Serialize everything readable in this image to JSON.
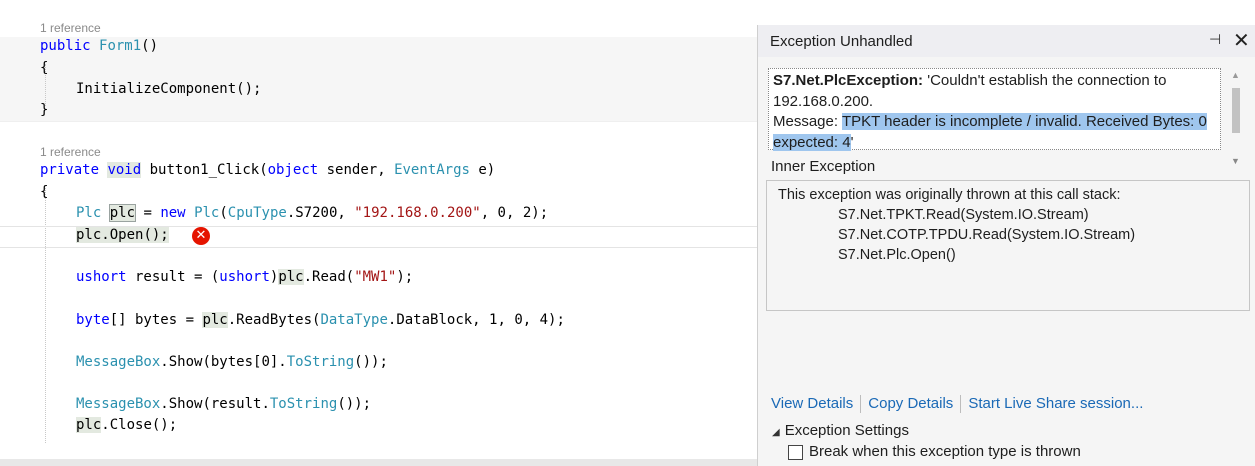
{
  "code": {
    "codelens_1": "1 reference",
    "line1": {
      "kw": "public",
      "name": "Form1",
      "rest": "()"
    },
    "brace_open_1": "{",
    "line_init": "InitializeComponent();",
    "brace_close_1": "}",
    "codelens_2": "1 reference",
    "line2": {
      "kw1": "private",
      "kw2": "void",
      "name": "button1_Click",
      "p1": "(",
      "kw3": "object",
      "p2": " sender, ",
      "type": "EventArgs",
      "p3": " e)"
    },
    "brace_open_2": "{",
    "line_plc": {
      "type1": "Plc",
      "var": "plc",
      "eq": " = ",
      "kw": "new",
      "type2": "Plc",
      "p1": "(",
      "type3": "CpuType",
      "p2": ".S7200, ",
      "str": "\"192.168.0.200\"",
      "p3": ", 0, 2);"
    },
    "line_open": {
      "var": "plc",
      "rest": ".Open();"
    },
    "line_read": {
      "kw": "ushort",
      "p1": " result = (",
      "kw2": "ushort",
      "p2": ")",
      "var": "plc",
      "p3": ".Read(",
      "str": "\"MW1\"",
      "p4": ");"
    },
    "line_bytes": {
      "kw": "byte",
      "p1": "[] bytes = ",
      "var": "plc",
      "p2": ".ReadBytes(",
      "type": "DataType",
      "p3": ".DataBlock, 1, 0, 4);"
    },
    "line_msg1": {
      "type": "MessageBox",
      "p1": ".Show(bytes[0].",
      "method": "ToString",
      "p2": "());"
    },
    "line_msg2": {
      "type": "MessageBox",
      "p1": ".Show(result.",
      "method": "ToString",
      "p2": "());"
    },
    "line_close": {
      "var": "plc",
      "rest": ".Close();"
    }
  },
  "popup": {
    "title": "Exception Unhandled",
    "pin_icon": "pin-icon",
    "close_icon": "close-icon",
    "exception_type": "S7.Net.PlcException:",
    "exception_msg": " 'Couldn't establish the connection to 192.168.0.200.",
    "message_label": "Message: ",
    "message_selected": "TPKT header is incomplete / invalid. Received Bytes: 0 expected: 4",
    "message_end": "'",
    "inner_exception_label": "Inner Exception",
    "stack_intro": "This exception was originally thrown at this call stack:",
    "stack_frames": [
      "S7.Net.TPKT.Read(System.IO.Stream)",
      "S7.Net.COTP.TPDU.Read(System.IO.Stream)",
      "S7.Net.Plc.Open()"
    ],
    "links": {
      "view_details": "View Details",
      "copy_details": "Copy Details",
      "live_share": "Start Live Share session..."
    },
    "settings_label": "Exception Settings",
    "break_label": "Break when this exception type is thrown",
    "break_checked": false
  },
  "colors": {
    "keyword": "#0000ff",
    "type": "#2b91af",
    "string": "#a31515",
    "error": "#e51400",
    "link": "#1a69b6",
    "selection": "#9fc6ee"
  }
}
